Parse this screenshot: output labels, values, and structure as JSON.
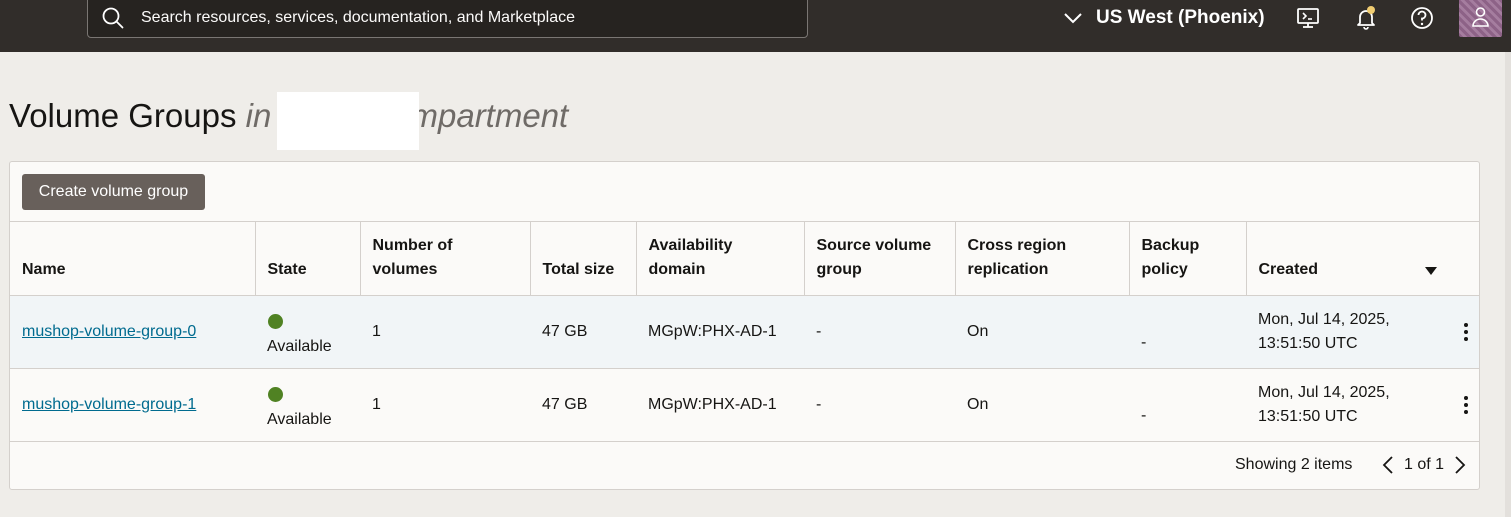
{
  "topbar": {
    "search_placeholder": "Search resources, services, documentation, and Marketplace",
    "region_label": "US West (Phoenix)",
    "icons": [
      "search-icon",
      "chevron-down-icon",
      "cloud-shell-icon",
      "bell-icon",
      "help-icon",
      "user-icon"
    ]
  },
  "page": {
    "title": "Volume Groups",
    "title_in": "in",
    "compartment_visible": "mpartment"
  },
  "toolbar": {
    "create_label": "Create volume group"
  },
  "table": {
    "columns": [
      {
        "key": "name",
        "label": "Name"
      },
      {
        "key": "state",
        "label": "State"
      },
      {
        "key": "num_volumes",
        "label": "Number of volumes"
      },
      {
        "key": "total_size",
        "label": "Total size"
      },
      {
        "key": "ad",
        "label": "Availability domain"
      },
      {
        "key": "source",
        "label": "Source volume group"
      },
      {
        "key": "replication",
        "label": "Cross region replication"
      },
      {
        "key": "backup",
        "label": "Backup policy"
      },
      {
        "key": "created",
        "label": "Created"
      }
    ],
    "rows": [
      {
        "name": "mushop-volume-group-0",
        "state": "Available",
        "num_volumes": "1",
        "total_size": "47 GB",
        "ad": "MGpW:PHX-AD-1",
        "source": "-",
        "replication": "On",
        "backup": "-",
        "created_line1": "Mon, Jul 14, 2025,",
        "created_line2": "13:51:50 UTC"
      },
      {
        "name": "mushop-volume-group-1",
        "state": "Available",
        "num_volumes": "1",
        "total_size": "47 GB",
        "ad": "MGpW:PHX-AD-1",
        "source": "-",
        "replication": "On",
        "backup": "-",
        "created_line1": "Mon, Jul 14, 2025,",
        "created_line2": "13:51:50 UTC"
      }
    ]
  },
  "footer": {
    "showing": "Showing 2 items",
    "page_info": "1 of 1"
  },
  "colors": {
    "topbar": "#312d2a",
    "available_dot": "#508223",
    "link": "#006b8f",
    "button": "#68605b"
  }
}
